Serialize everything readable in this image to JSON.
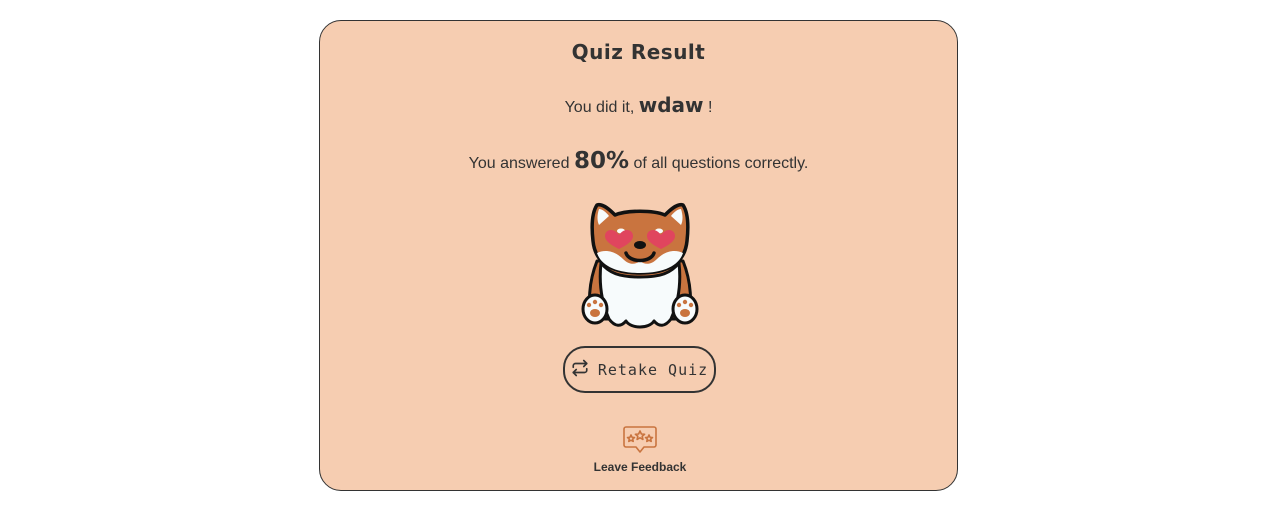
{
  "quiz": {
    "title": "Quiz Result",
    "greeting_prefix": "You did it,",
    "user_name": "wdaw",
    "greeting_suffix": "!",
    "score_prefix": "You answered",
    "score": "80%",
    "score_suffix": "of all questions correctly."
  },
  "mascot": {
    "icon": "shiba-dog-hearts-icon"
  },
  "actions": {
    "retake_label": "Retake Quiz",
    "retake_icon": "repeat-icon",
    "feedback_label": "Leave Feedback",
    "feedback_icon": "star-rating-bubble-icon"
  },
  "colors": {
    "card_background": "#f6cdb1",
    "text": "#333333",
    "accent": "#c9743f",
    "heart": "#e0455e"
  }
}
